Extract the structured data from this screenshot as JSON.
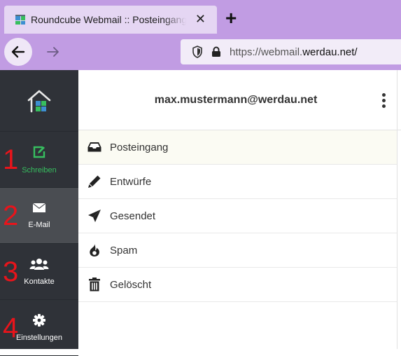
{
  "browser": {
    "tab_title": "Roundcube Webmail :: Posteingang",
    "close_glyph": "✕",
    "newtab_glyph": "+",
    "url_prefix": "https://webmail.",
    "url_domain": "werdau.net/",
    "accent": "#c19ce3"
  },
  "sidebar": {
    "items": [
      {
        "label": "Schreiben",
        "number": "1",
        "icon": "compose-icon",
        "color": "#37be5f"
      },
      {
        "label": "E-Mail",
        "number": "2",
        "icon": "envelope-icon",
        "active": true
      },
      {
        "label": "Kontakte",
        "number": "3",
        "icon": "users-icon"
      },
      {
        "label": "Einstellungen",
        "number": "4",
        "icon": "gear-icon"
      }
    ]
  },
  "header": {
    "account": "max.mustermann@werdau.net"
  },
  "folders": [
    {
      "label": "Posteingang",
      "icon": "inbox-icon",
      "selected": true
    },
    {
      "label": "Entwürfe",
      "icon": "pencil-icon"
    },
    {
      "label": "Gesendet",
      "icon": "paper-plane-icon"
    },
    {
      "label": "Spam",
      "icon": "fire-icon"
    },
    {
      "label": "Gelöscht",
      "icon": "trash-icon"
    }
  ]
}
